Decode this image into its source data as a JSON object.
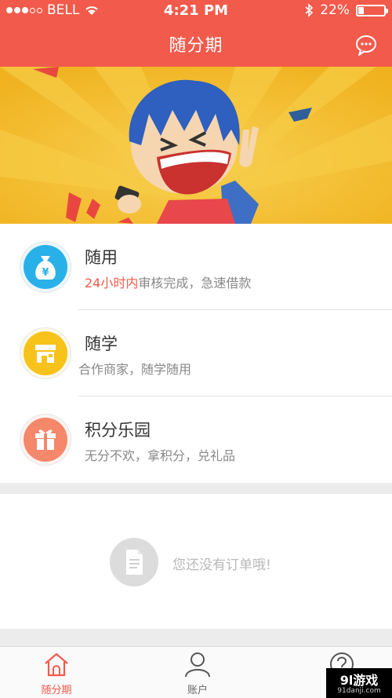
{
  "status_bar": {
    "carrier": "BELL",
    "time": "4:21 PM",
    "battery_percent": "22%",
    "battery_level": 0.22
  },
  "header": {
    "title": "随分期",
    "chat_icon": "chat-bubble-icon"
  },
  "menu": [
    {
      "title": "随用",
      "desc_highlight": "24小时内",
      "desc": "审核完成，急速借款",
      "icon": "money-bag-icon",
      "color": "#2ab0e8"
    },
    {
      "title": "随学",
      "desc_highlight": "",
      "desc": "合作商家，随学随用",
      "icon": "store-icon",
      "color": "#f7c21a"
    },
    {
      "title": "积分乐园",
      "desc_highlight": "",
      "desc": "无分不欢，拿积分，兑礼品",
      "icon": "gift-icon",
      "color": "#f5876a"
    }
  ],
  "empty_state": {
    "text": "您还没有订单哦!",
    "icon": "document-icon"
  },
  "tabbar": [
    {
      "label": "随分期",
      "icon": "home-icon",
      "active": true
    },
    {
      "label": "账户",
      "icon": "user-icon",
      "active": false
    },
    {
      "label": "",
      "icon": "help-icon",
      "active": false
    }
  ],
  "watermark": {
    "main": "9l游戏",
    "sub": "91danji.com"
  },
  "colors": {
    "accent": "#f25a4b",
    "banner": "#f4c232"
  }
}
